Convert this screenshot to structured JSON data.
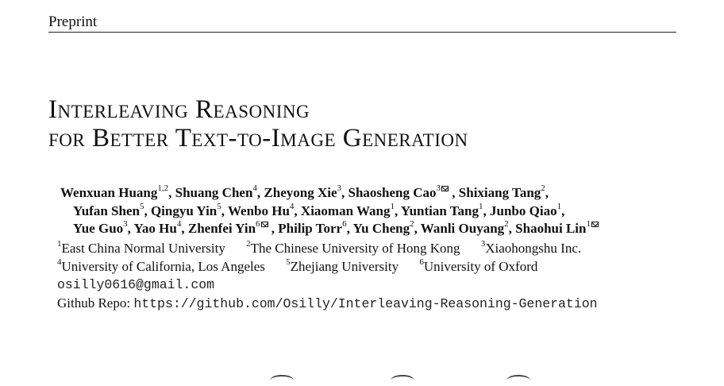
{
  "header": {
    "label": "Preprint"
  },
  "title": {
    "line1": "Interleaving Reasoning",
    "line2": "for Better Text-to-Image Generation"
  },
  "authors": {
    "lines": [
      [
        {
          "name": "Wenxuan Huang",
          "sup": "1,2",
          "sep": ", "
        },
        {
          "name": "Shuang Chen",
          "sup": "4",
          "sep": ", "
        },
        {
          "name": "Zheyong Xie",
          "sup": "3",
          "sep": ", "
        },
        {
          "name": "Shaosheng Cao",
          "sup": "3",
          "mail": true,
          "sep": " , "
        },
        {
          "name": "Shixiang Tang",
          "sup": "2",
          "sep": ","
        }
      ],
      [
        {
          "name": "Yufan Shen",
          "sup": "5",
          "sep": ", "
        },
        {
          "name": "Qingyu Yin",
          "sup": "5",
          "sep": ", "
        },
        {
          "name": "Wenbo Hu",
          "sup": "4",
          "sep": ", "
        },
        {
          "name": "Xiaoman Wang",
          "sup": "1",
          "sep": ", "
        },
        {
          "name": "Yuntian Tang",
          "sup": "1",
          "sep": ", "
        },
        {
          "name": "Junbo Qiao",
          "sup": "1",
          "sep": ","
        }
      ],
      [
        {
          "name": "Yue Guo",
          "sup": "3",
          "sep": ", "
        },
        {
          "name": "Yao Hu",
          "sup": "4",
          "sep": ", "
        },
        {
          "name": "Zhenfei Yin",
          "sup": "6",
          "mail": true,
          "sep": " , "
        },
        {
          "name": "Philip Torr",
          "sup": "6",
          "sep": ", "
        },
        {
          "name": "Yu Cheng",
          "sup": "2",
          "sep": ", "
        },
        {
          "name": "Wanli Ouyang",
          "sup": "2",
          "sep": ", "
        },
        {
          "name": "Shaohui Lin",
          "sup": "1",
          "mail": true,
          "sep": ""
        }
      ]
    ]
  },
  "affiliations": [
    {
      "num": "1",
      "name": "East China Normal University"
    },
    {
      "num": "2",
      "name": "The Chinese University of Hong Kong"
    },
    {
      "num": "3",
      "name": "Xiaohongshu Inc."
    },
    {
      "num": "4",
      "name": "University of California, Los Angeles"
    },
    {
      "num": "5",
      "name": "Zhejiang University"
    },
    {
      "num": "6",
      "name": "University of Oxford"
    }
  ],
  "contact": {
    "email": "osilly0616@gmail.com",
    "repo_label": "Github Repo: ",
    "repo_url": "https://github.com/Osilly/Interleaving-Reasoning-Generation"
  }
}
